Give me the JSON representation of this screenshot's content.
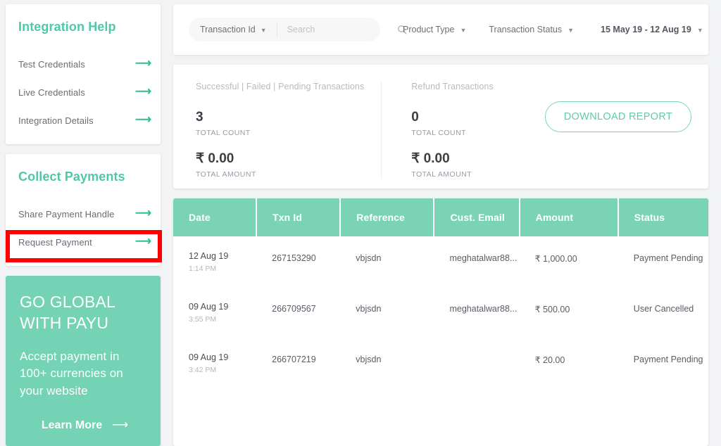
{
  "sidebar": {
    "integration": {
      "title": "Integration Help",
      "links": [
        {
          "label": "Test Credentials",
          "arrow": "arrow-right-icon"
        },
        {
          "label": "Live Credentials",
          "arrow": "arrow-right-icon"
        },
        {
          "label": "Integration Details",
          "arrow": "arrow-right-icon"
        }
      ]
    },
    "collect": {
      "title": "Collect Payments",
      "links": [
        {
          "label": "Share Payment Handle",
          "arrow": "arrow-right-icon"
        },
        {
          "label": "Request Payment",
          "arrow": "arrow-right-icon"
        }
      ]
    },
    "promo": {
      "heading": "GO GLOBAL\nWITH PAYU",
      "body": "Accept payment in\n100+ currencies on\nyour website",
      "cta": "Learn More",
      "cta_arrow": "arrow-right-icon"
    },
    "highlight": {
      "target": "Request Payment",
      "color": "#ff0000"
    }
  },
  "filters": {
    "search_field": "Transaction Id",
    "search_value": "",
    "search_placeholder": "Search",
    "search_icon": "search-icon",
    "product_type": "Product Type",
    "transaction_status": "Transaction Status",
    "date_range": "15 May 19 - 12 Aug 19",
    "caret": "chevron-down-icon"
  },
  "summary": {
    "primary": {
      "label": "Successful | Failed | Pending Transactions",
      "count": "3",
      "count_caption": "TOTAL COUNT",
      "amount": "₹ 0.00",
      "amount_caption": "TOTAL AMOUNT"
    },
    "refund": {
      "label": "Refund Transactions",
      "count": "0",
      "count_caption": "TOTAL COUNT",
      "amount": "₹ 0.00",
      "amount_caption": "TOTAL AMOUNT"
    },
    "download_button": "DOWNLOAD REPORT"
  },
  "table": {
    "columns": [
      "Date",
      "Txn Id",
      "Reference",
      "Cust. Email",
      "Amount",
      "Status"
    ],
    "rows": [
      {
        "date": "12 Aug 19",
        "time": "1:14 PM",
        "txn_id": "267153290",
        "reference": "vbjsdn",
        "email": "meghatalwar88...",
        "amount": "₹ 1,000.00",
        "status": "Payment Pending"
      },
      {
        "date": "09 Aug 19",
        "time": "3:55 PM",
        "txn_id": "266709567",
        "reference": "vbjsdn",
        "email": "meghatalwar88...",
        "amount": "₹ 500.00",
        "status": "User Cancelled"
      },
      {
        "date": "09 Aug 19",
        "time": "3:42 PM",
        "txn_id": "266707219",
        "reference": "vbjsdn",
        "email": "",
        "amount": "₹ 20.00",
        "status": "Payment Pending"
      }
    ]
  },
  "colors": {
    "brand_green": "#4ec9a8",
    "header_green": "#79d3b4",
    "promo_green": "#74d3b4",
    "page_bg": "#f2f3f4",
    "highlight_red": "#ff0000"
  }
}
